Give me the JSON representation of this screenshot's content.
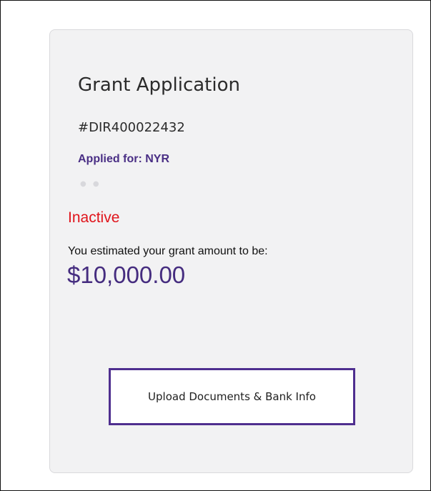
{
  "card": {
    "title": "Grant Application",
    "application_id": "#DIR400022432",
    "applied_for": "Applied for: NYR",
    "status": "Inactive",
    "estimate_label": "You estimated your grant amount to be:",
    "amount": "$10,000.00",
    "upload_button_label": "Upload Documents & Bank Info"
  },
  "colors": {
    "status_inactive": "#e0141b",
    "accent_purple": "#4f2f8f",
    "card_background": "#f2f2f3"
  }
}
